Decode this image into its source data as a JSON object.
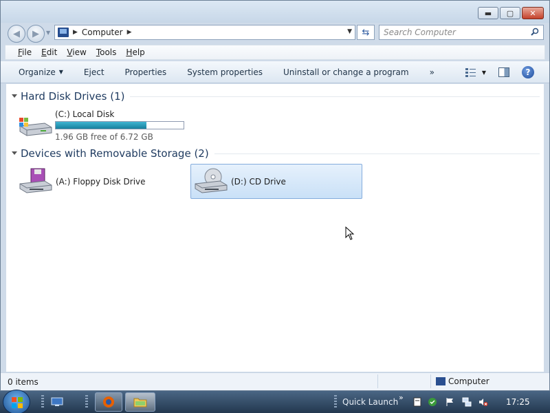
{
  "window": {
    "caption_buttons": [
      "minimize",
      "maximize",
      "close"
    ]
  },
  "address": {
    "path_label": "Computer",
    "search_placeholder": "Search Computer"
  },
  "menubar": {
    "items": [
      {
        "label": "File",
        "accel": "F",
        "rest": "ile"
      },
      {
        "label": "Edit",
        "accel": "E",
        "rest": "dit"
      },
      {
        "label": "View",
        "accel": "V",
        "rest": "iew"
      },
      {
        "label": "Tools",
        "accel": "T",
        "rest": "ools"
      },
      {
        "label": "Help",
        "accel": "H",
        "rest": "elp"
      }
    ]
  },
  "commandbar": {
    "organize": "Organize",
    "eject": "Eject",
    "properties": "Properties",
    "system_properties": "System properties",
    "uninstall": "Uninstall or change a program",
    "more": "»"
  },
  "groups": {
    "hard_disks": {
      "title": "Hard Disk Drives (1)",
      "items": [
        {
          "name": "(C:) Local Disk",
          "free_text": "1.96 GB free of 6.72 GB",
          "used_fraction": 0.708
        }
      ]
    },
    "removable": {
      "title": "Devices with Removable Storage (2)",
      "items": [
        {
          "name": "(A:) Floppy Disk Drive",
          "selected": false
        },
        {
          "name": "(D:) CD Drive",
          "selected": true
        }
      ]
    }
  },
  "statusbar": {
    "items_count": "0 items",
    "zone": "Computer"
  },
  "taskbar": {
    "quick_launch": "Quick Launch",
    "chevron": "»",
    "clock": "17:25"
  },
  "colors": {
    "disk_fill": "#26a0c0",
    "selection": "#cfe3f8"
  }
}
